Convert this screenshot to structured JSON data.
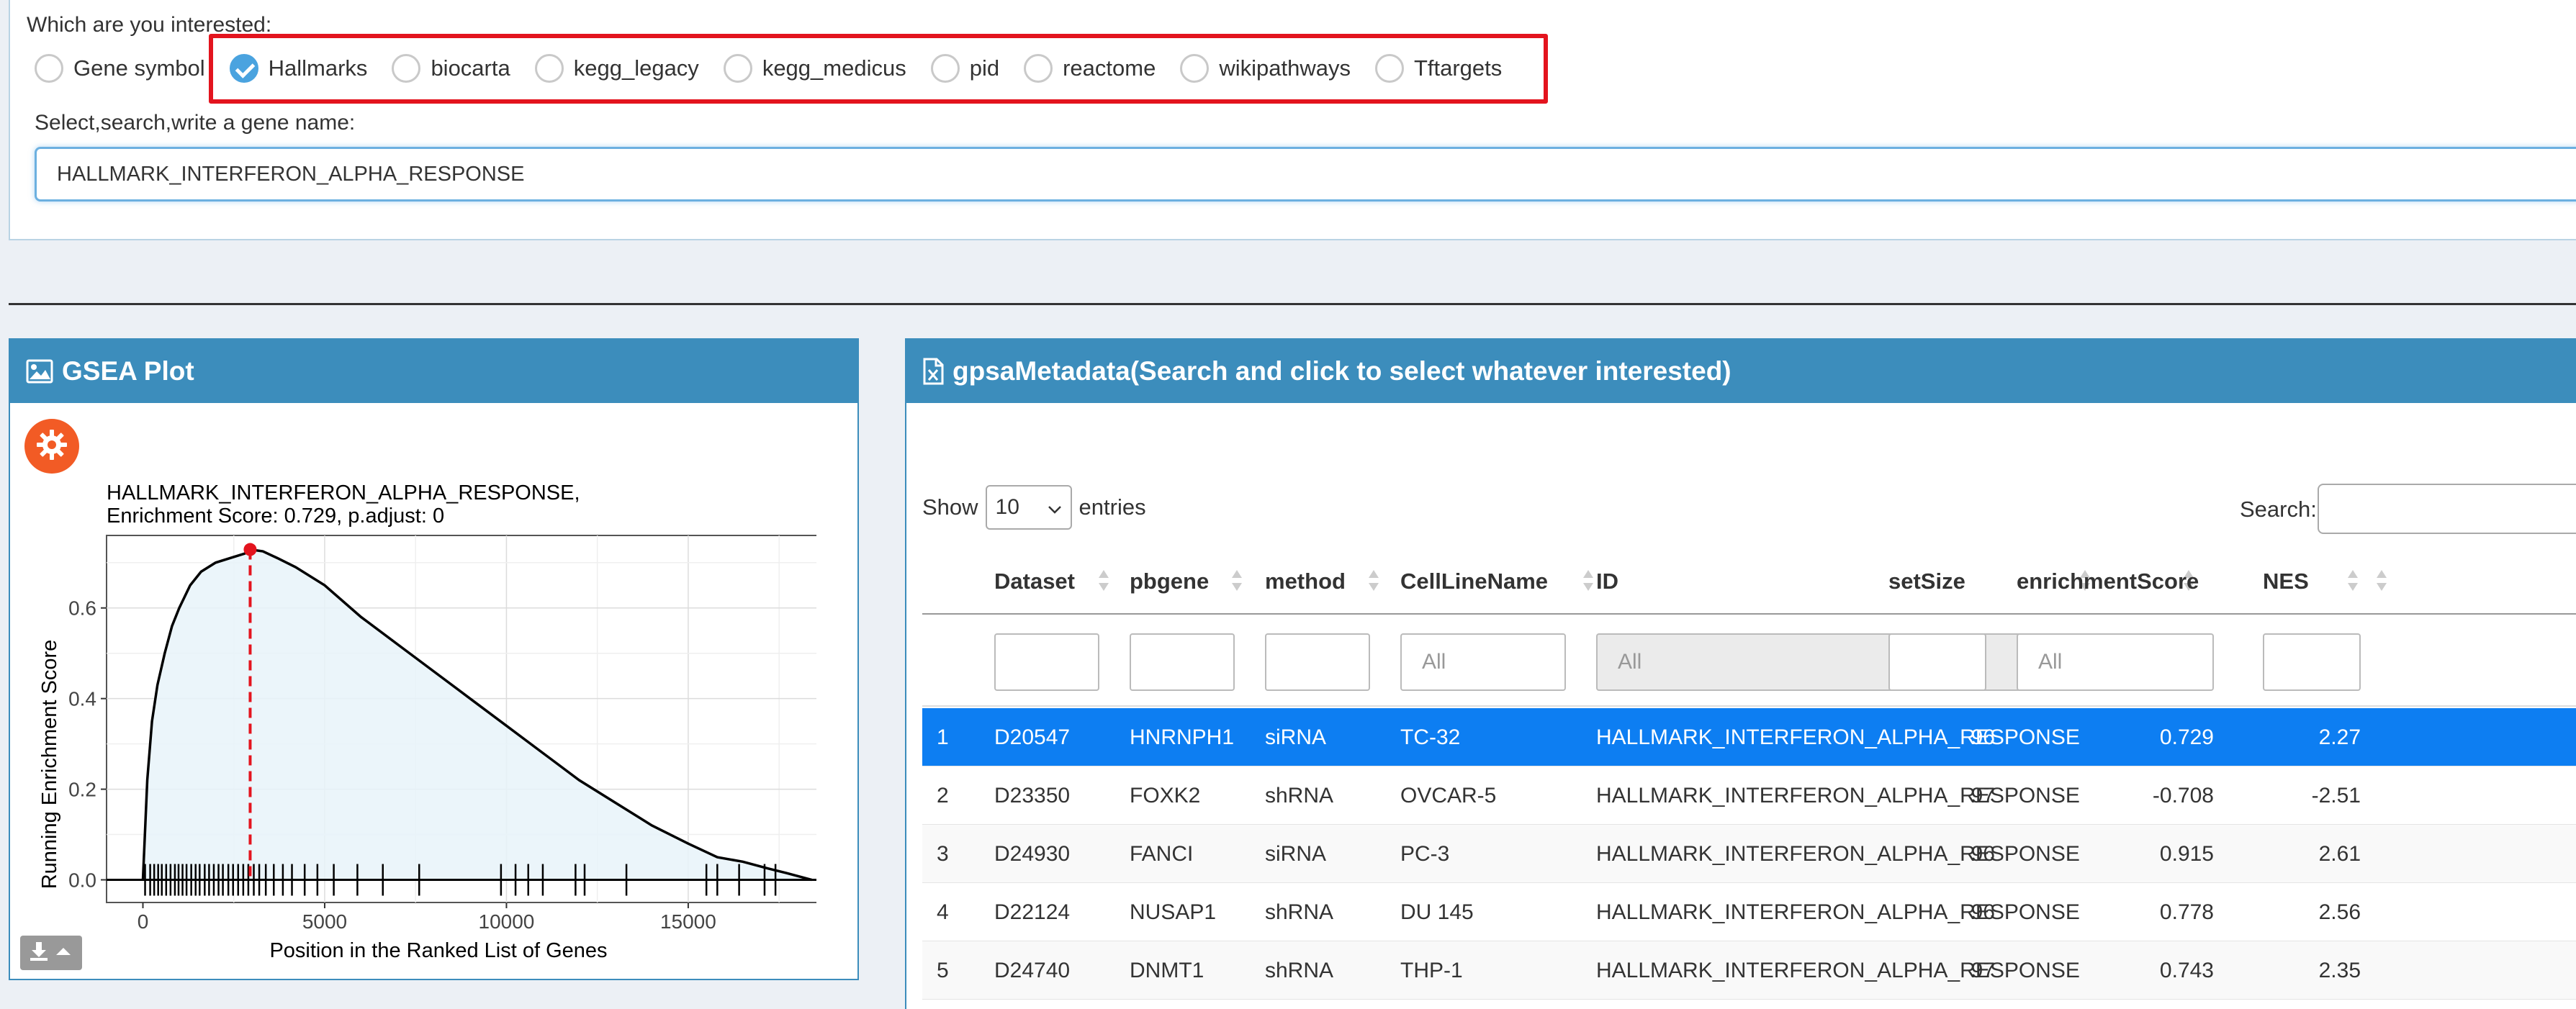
{
  "selector": {
    "question": "Which are you interested:",
    "options": [
      {
        "label": "Gene symbol",
        "checked": false
      },
      {
        "label": "Hallmarks",
        "checked": true
      },
      {
        "label": "biocarta",
        "checked": false
      },
      {
        "label": "kegg_legacy",
        "checked": false
      },
      {
        "label": "kegg_medicus",
        "checked": false
      },
      {
        "label": "pid",
        "checked": false
      },
      {
        "label": "reactome",
        "checked": false
      },
      {
        "label": "wikipathways",
        "checked": false
      },
      {
        "label": "Tftargets",
        "checked": false
      }
    ],
    "gene_label": "Select,search,write a gene name:",
    "gene_value": "HALLMARK_INTERFERON_ALPHA_RESPONSE"
  },
  "gsea_panel": {
    "title": "GSEA Plot",
    "icon": "image-icon",
    "settings_icon": "gear-icon",
    "download_icon": "download-icon"
  },
  "chart_data": {
    "type": "line",
    "title": "HALLMARK_INTERFERON_ALPHA_RESPONSE,",
    "subtitle": "Enrichment Score: 0.729, p.adjust: 0",
    "xlabel": "Position in the Ranked List of Genes",
    "ylabel": "Running Enrichment Score",
    "xlim": [
      -1000,
      19200
    ],
    "ylim": [
      -0.05,
      0.76
    ],
    "xticks": [
      0,
      5000,
      10000,
      15000
    ],
    "xtick_labels": [
      "0",
      "5000",
      "10000",
      "15000"
    ],
    "yticks": [
      0.0,
      0.2,
      0.4,
      0.6
    ],
    "ytick_labels": [
      "0.0",
      "0.2",
      "0.4",
      "0.6"
    ],
    "grid": true,
    "peak": {
      "x": 2950,
      "y": 0.729
    },
    "series": [
      {
        "x": [
          0,
          120,
          250,
          400,
          600,
          800,
          1000,
          1300,
          1600,
          2000,
          2400,
          2800,
          2950,
          3300,
          3700,
          4200,
          5000,
          6000,
          7000,
          8000,
          9000,
          10000,
          11000,
          12000,
          13000,
          14000,
          15000,
          15800,
          16500,
          17200,
          17700,
          18400
        ],
        "y": [
          0.0,
          0.22,
          0.35,
          0.43,
          0.5,
          0.56,
          0.6,
          0.65,
          0.68,
          0.7,
          0.71,
          0.72,
          0.729,
          0.725,
          0.71,
          0.69,
          0.65,
          0.58,
          0.52,
          0.46,
          0.4,
          0.34,
          0.28,
          0.22,
          0.17,
          0.12,
          0.08,
          0.05,
          0.04,
          0.025,
          0.015,
          0.0
        ]
      }
    ],
    "hits": [
      60,
      200,
      310,
      420,
      520,
      640,
      760,
      880,
      980,
      1090,
      1200,
      1330,
      1450,
      1560,
      1700,
      1820,
      1950,
      2080,
      2200,
      2350,
      2480,
      2620,
      2760,
      2900,
      3050,
      3200,
      3380,
      3600,
      3850,
      4100,
      4450,
      4800,
      5250,
      5900,
      6600,
      7600,
      9850,
      10250,
      10600,
      11000,
      11900,
      12150,
      13300,
      15500,
      15800,
      16400,
      17100,
      17400
    ]
  },
  "meta_panel": {
    "title": "gpsaMetadata(Search and click to select whatever interested)",
    "icon": "file-excel-icon",
    "show_label": "Show",
    "entries_value": "10",
    "entries_label": "entries",
    "search_label": "Search:",
    "columns": [
      "Dataset",
      "pbgene",
      "method",
      "CellLineName",
      "ID",
      "setSize",
      "enrichmentScore",
      "NES"
    ],
    "filter_placeholder_all": "All",
    "rows": [
      {
        "n": "1",
        "Dataset": "D20547",
        "pbgene": "HNRNPH1",
        "method": "siRNA",
        "CellLineName": "TC-32",
        "ID": "HALLMARK_INTERFERON_ALPHA_RESPONSE",
        "setSize": "96",
        "enrichmentScore": "0.729",
        "NES": "2.27",
        "selected": true
      },
      {
        "n": "2",
        "Dataset": "D23350",
        "pbgene": "FOXK2",
        "method": "shRNA",
        "CellLineName": "OVCAR-5",
        "ID": "HALLMARK_INTERFERON_ALPHA_RESPONSE",
        "setSize": "97",
        "enrichmentScore": "-0.708",
        "NES": "-2.51",
        "selected": false
      },
      {
        "n": "3",
        "Dataset": "D24930",
        "pbgene": "FANCI",
        "method": "siRNA",
        "CellLineName": "PC-3",
        "ID": "HALLMARK_INTERFERON_ALPHA_RESPONSE",
        "setSize": "96",
        "enrichmentScore": "0.915",
        "NES": "2.61",
        "selected": false
      },
      {
        "n": "4",
        "Dataset": "D22124",
        "pbgene": "NUSAP1",
        "method": "shRNA",
        "CellLineName": "DU 145",
        "ID": "HALLMARK_INTERFERON_ALPHA_RESPONSE",
        "setSize": "96",
        "enrichmentScore": "0.778",
        "NES": "2.56",
        "selected": false
      },
      {
        "n": "5",
        "Dataset": "D24740",
        "pbgene": "DNMT1",
        "method": "shRNA",
        "CellLineName": "THP-1",
        "ID": "HALLMARK_INTERFERON_ALPHA_RESPONSE",
        "setSize": "97",
        "enrichmentScore": "0.743",
        "NES": "2.35",
        "selected": false
      }
    ]
  },
  "colors": {
    "panel_blue": "#3c8dbc",
    "selected_row": "#0d7ef2",
    "highlight_red": "#e3141e",
    "gear_orange": "#f25b25"
  }
}
